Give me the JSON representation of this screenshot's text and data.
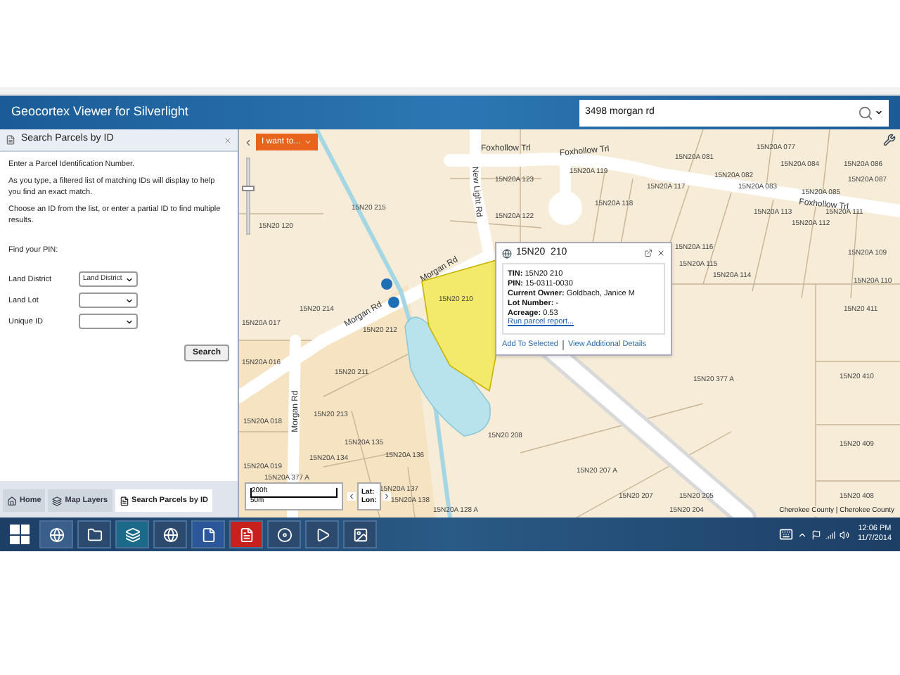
{
  "app_title": "Geocortex Viewer for Silverlight",
  "search": {
    "value": "3498 morgan rd"
  },
  "panel": {
    "title": "Search Parcels by ID",
    "paragraphs": [
      "Enter a Parcel Identification Number.",
      "As you type, a filtered list of matching IDs will display to help you find an exact match.",
      "Choose an ID from the list, or enter a partial ID to find multiple results."
    ],
    "find_label": "Find your PIN:",
    "fields": [
      {
        "label": "Land District",
        "value": "Land District"
      },
      {
        "label": "Land Lot"
      },
      {
        "label": "Unique ID"
      }
    ],
    "search_button": "Search"
  },
  "bottom_tabs": [
    {
      "label": "Home",
      "kind": "home",
      "selected": false
    },
    {
      "label": "Map Layers",
      "kind": "layers",
      "selected": false
    },
    {
      "label": "Search Parcels by ID",
      "kind": "search",
      "selected": true
    }
  ],
  "map": {
    "menu_button": "I want to...",
    "parcels": [
      "15N20A 123",
      "15N20A 119",
      "15N20A 081",
      "15N20A 077",
      "15N20A 084",
      "15N20A 086",
      "15N20A 082",
      "15N20A 083",
      "15N20A 117",
      "15N20A 087",
      "15N20A 085",
      "15N20A 118",
      "15N20A 122",
      "15N20A 113",
      "15N20A 111",
      "15N20A 112",
      "15N20 215",
      "15N20 120",
      "15N20A 116",
      "15N20A 115",
      "15N20A 114",
      "15N20A 109",
      "15N20A 110",
      "15N20 411",
      "15N20 214",
      "15N20A 017",
      "15N20 212",
      "15N20 210",
      "15N20A 016",
      "15N20 211",
      "15N20 377 A",
      "15N20 410",
      "15N20 213",
      "15N20A 018",
      "15N20 208",
      "15N20A 135",
      "15N20A 136",
      "15N20A 134",
      "15N20A 019",
      "15N20 409",
      "15N20 207 A",
      "15N20A 377 A",
      "15N20A 137",
      "15N20A 138",
      "15N20 207",
      "15N20 205",
      "15N20 408",
      "15N20A 128 A",
      "15N20 204"
    ],
    "roads": [
      "Foxhollow Trl",
      "Foxhollow Trl",
      "Foxhollow Trl",
      "New Light Rd",
      "Morgan Rd",
      "Morgan Rd",
      "Morgan Rd"
    ],
    "zoom": {
      "level": 0.6
    },
    "scale": {
      "feet": "200ft",
      "meters": "50m"
    },
    "coords": {
      "lat": "Lat:",
      "lon": "Lon:"
    },
    "attribution": "Cherokee County | Cherokee County"
  },
  "popup": {
    "title": "15N20  210",
    "lines": [
      "**TIN:** 15N20 210",
      "**PIN:** 15-0311-0030",
      "**Current Owner:** Goldbach, Janice M",
      "**Lot Number:** -",
      "**Acreage:** 0.53"
    ],
    "link": "Run parcel report...",
    "actions": [
      "Add To Selected",
      "View Additional Details"
    ]
  },
  "taskbar": {
    "apps": [
      {
        "kind": "windows"
      },
      {
        "kind": "browser"
      },
      {
        "kind": "folder"
      },
      {
        "kind": "media"
      },
      {
        "kind": "globe"
      },
      {
        "kind": "document"
      },
      {
        "kind": "pdf"
      },
      {
        "kind": "disc"
      },
      {
        "kind": "player"
      },
      {
        "kind": "photos"
      }
    ],
    "time": "12:06 PM",
    "date": "11/7/2014"
  }
}
